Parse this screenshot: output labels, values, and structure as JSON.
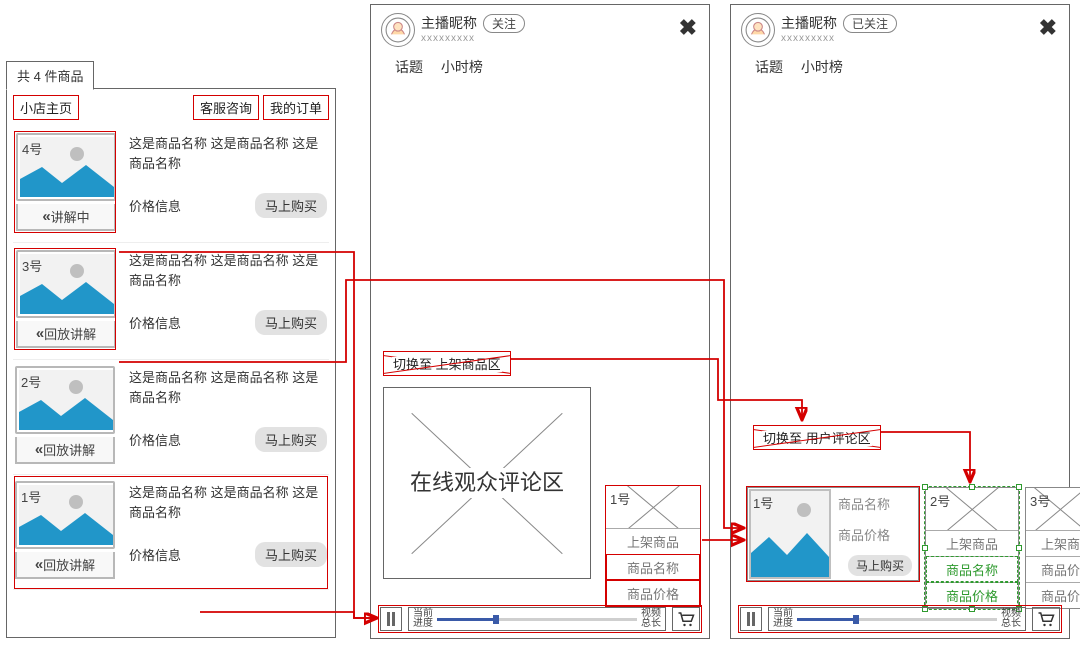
{
  "panelA": {
    "header_tab": "共 4 件商品",
    "shop_home": "小店主页",
    "service": "客服咨询",
    "my_orders": "我的订单",
    "items": [
      {
        "num": "4号",
        "title": "这是商品名称 这是商品名称 这是商品名称",
        "price": "价格信息",
        "buy": "马上购买",
        "badge": "讲解中"
      },
      {
        "num": "3号",
        "title": "这是商品名称 这是商品名称 这是商品名称",
        "price": "价格信息",
        "buy": "马上购买",
        "badge": "回放讲解"
      },
      {
        "num": "2号",
        "title": "这是商品名称 这是商品名称 这是商品名称",
        "price": "价格信息",
        "buy": "马上购买",
        "badge": "回放讲解"
      },
      {
        "num": "1号",
        "title": "这是商品名称 这是商品名称 这是商品名称",
        "price": "价格信息",
        "buy": "马上购买",
        "badge": "回放讲解"
      }
    ]
  },
  "phone": {
    "streamer_name": "主播昵称",
    "streamer_sub": "xxxxxxxxx",
    "follow": "关注",
    "followed": "已关注",
    "tab_topic": "话题",
    "tab_hour": "小时榜"
  },
  "panelB": {
    "switch_label": "切换至 上架商品区",
    "comment_area": "在线观众评论区",
    "card1_num": "1号",
    "card1_row1": "上架商品",
    "card1_row2": "商品名称",
    "card1_row3": "商品价格"
  },
  "panelC": {
    "switch_label": "切换至 用户评论区",
    "big_num": "1号",
    "big_name": "商品名称",
    "big_price": "商品价格",
    "big_buy": "马上购买",
    "card2_num": "2号",
    "card2_row1": "上架商品",
    "card2_row2": "商品名称",
    "card2_row3": "商品价格",
    "card3_num": "3号",
    "card3_row1": "上架商",
    "card3_row2": "商品价",
    "card3_row3": "商品价"
  },
  "player": {
    "left_top": "当前",
    "left_bot": "进度",
    "right_top": "视频",
    "right_bot": "总长"
  }
}
